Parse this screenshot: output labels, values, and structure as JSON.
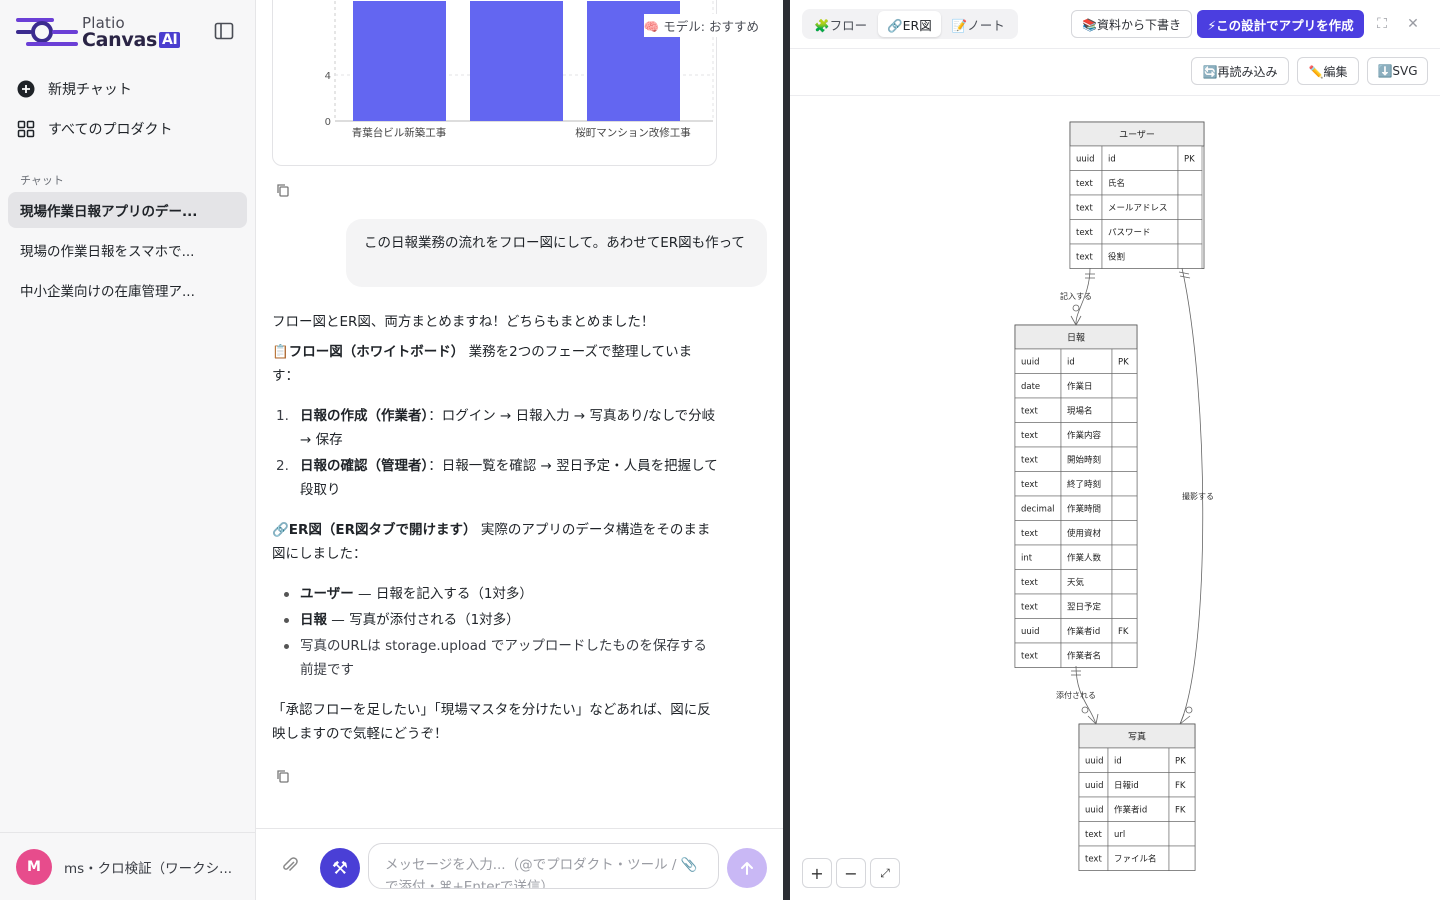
{
  "app": {
    "logo_top": "Platio",
    "logo_main": "Canvas",
    "logo_ai": "AI"
  },
  "sidebar": {
    "new_chat": "新規チャット",
    "all_products": "すべてのプロダクト",
    "section_chat": "チャット",
    "chats": [
      "現場作業日報アプリのデー...",
      "現場の作業日報をスマホで...",
      "中小企業向けの在庫管理ア..."
    ],
    "user": {
      "initial": "M",
      "name": "ms・クロ検証（ワークシ..."
    }
  },
  "chat": {
    "model": "🧠 モデル: おすすめ",
    "chart": {
      "y_ticks": [
        "4",
        "0"
      ],
      "categories": [
        "青葉台ビル新築工事",
        "桜町マンション改修工事"
      ]
    },
    "user_message": "この日報業務の流れをフロー図にして。あわせてER図も作って",
    "reply_intro": "フロー図とER図、両方まとめますね！どちらもまとめました！",
    "flow_heading": "📋フロー図（ホワイトボード）",
    "flow_heading_rest": " 業務を2つのフェーズで整理しています：",
    "flow_items": [
      {
        "num": "1.",
        "bold": "日報の作成（作業者）",
        "text": "：ログイン → 日報入力 → 写真あり/なしで分岐 → 保存"
      },
      {
        "num": "2.",
        "bold": "日報の確認（管理者）",
        "text": "：日報一覧を確認 → 翌日予定・人員を把握して段取り"
      }
    ],
    "er_heading": "🔗ER図（ER図タブで開けます）",
    "er_heading_rest": " 実際のアプリのデータ構造をそのまま図にしました：",
    "er_items": [
      {
        "bold": "ユーザー",
        "text": " — 日報を記入する（1対多）"
      },
      {
        "bold": "日報",
        "text": " — 写真が添付される（1対多）"
      },
      {
        "bold": "",
        "text": "写真のURLは storage.upload でアップロードしたものを保存する前提です"
      }
    ],
    "closing": "「承認フローを足したい」「現場マスタを分けたい」などあれば、図に反映しますので気軽にどうぞ！",
    "input_placeholder": "メッセージを入力...（@でプロダクト・ツール / 📎で添付・⌘+Enterで送信）"
  },
  "panel": {
    "tabs": [
      "🧩フロー",
      "🔗ER図",
      "📝ノート"
    ],
    "active_tab": 1,
    "draft_button": "📚資料から下書き",
    "create_button": "⚡この設計でアプリを作成",
    "reload_button": "🔄再読み込み",
    "edit_button": "✏️編集",
    "svg_button": "⬇️SVG"
  },
  "er": {
    "entities": [
      {
        "name": "ユーザー",
        "rows": [
          [
            "uuid",
            "id",
            "PK"
          ],
          [
            "text",
            "氏名",
            ""
          ],
          [
            "text",
            "メールアドレス",
            ""
          ],
          [
            "text",
            "パスワード",
            ""
          ],
          [
            "text",
            "役割",
            ""
          ]
        ]
      },
      {
        "name": "日報",
        "rows": [
          [
            "uuid",
            "id",
            "PK"
          ],
          [
            "date",
            "作業日",
            ""
          ],
          [
            "text",
            "現場名",
            ""
          ],
          [
            "text",
            "作業内容",
            ""
          ],
          [
            "text",
            "開始時刻",
            ""
          ],
          [
            "text",
            "終了時刻",
            ""
          ],
          [
            "decimal",
            "作業時間",
            ""
          ],
          [
            "text",
            "使用資材",
            ""
          ],
          [
            "int",
            "作業人数",
            ""
          ],
          [
            "text",
            "天気",
            ""
          ],
          [
            "text",
            "翌日予定",
            ""
          ],
          [
            "uuid",
            "作業者id",
            "FK"
          ],
          [
            "text",
            "作業者名",
            ""
          ]
        ]
      },
      {
        "name": "写真",
        "rows": [
          [
            "uuid",
            "id",
            "PK"
          ],
          [
            "uuid",
            "日報id",
            "FK"
          ],
          [
            "uuid",
            "作業者id",
            "FK"
          ],
          [
            "text",
            "url",
            ""
          ],
          [
            "text",
            "ファイル名",
            ""
          ]
        ]
      }
    ],
    "relations": [
      "記入する",
      "撮影する",
      "添付される"
    ]
  },
  "colors": {
    "accent": "#4b3ee0",
    "bar": "#6366f1",
    "avatar": "#e74c8c"
  }
}
